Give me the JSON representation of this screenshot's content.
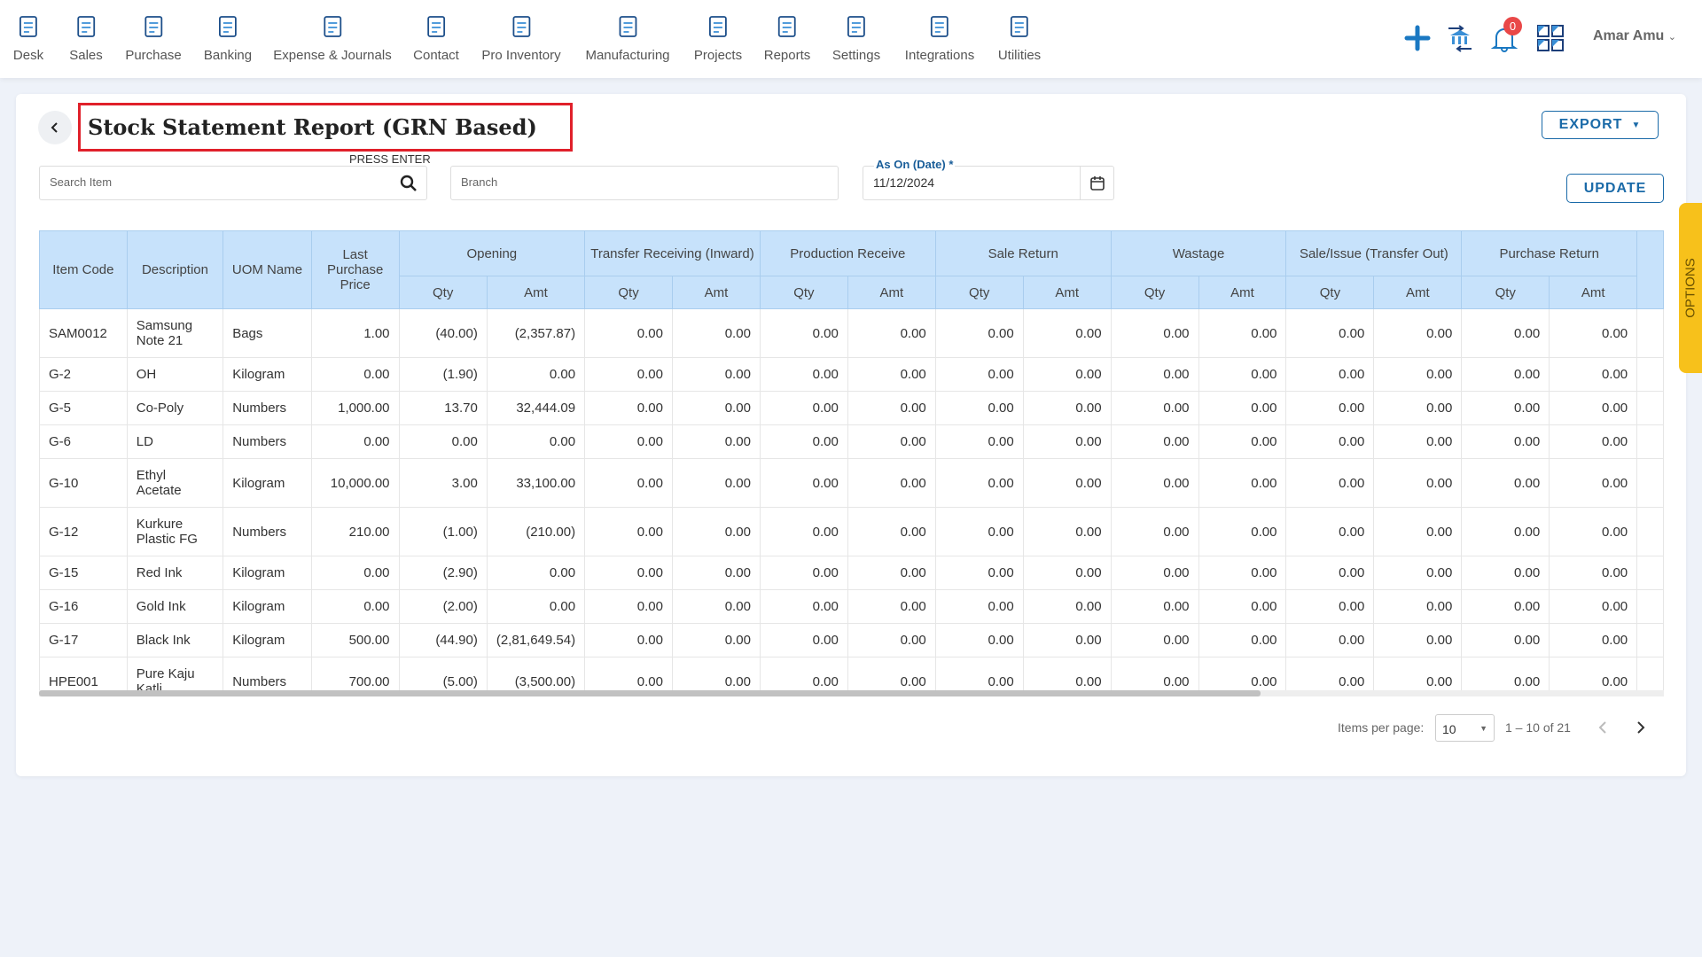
{
  "nav": {
    "items": [
      {
        "label": "Desk",
        "icon": "desk-icon"
      },
      {
        "label": "Sales",
        "icon": "sales-icon"
      },
      {
        "label": "Purchase",
        "icon": "cart-icon"
      },
      {
        "label": "Banking",
        "icon": "bank-icon"
      },
      {
        "label": "Expense & Journals",
        "icon": "journal-icon"
      },
      {
        "label": "Contact",
        "icon": "contact-icon"
      },
      {
        "label": "Pro Inventory",
        "icon": "inventory-icon"
      },
      {
        "label": "Manufacturing",
        "icon": "manufacturing-icon"
      },
      {
        "label": "Projects",
        "icon": "projects-icon"
      },
      {
        "label": "Reports",
        "icon": "reports-icon"
      },
      {
        "label": "Settings",
        "icon": "settings-icon"
      },
      {
        "label": "Integrations",
        "icon": "integrations-icon"
      },
      {
        "label": "Utilities",
        "icon": "utilities-icon"
      }
    ],
    "notification_count": "0",
    "user": "Amar Amu"
  },
  "page": {
    "title": "Stock Statement Report (GRN Based)",
    "press_enter": "PRESS ENTER",
    "search_placeholder": "Search Item",
    "branch_placeholder": "Branch",
    "date_label": "As On (Date) *",
    "date_value": "11/12/2024",
    "export": "EXPORT",
    "update": "UPDATE",
    "options": "OPTIONS"
  },
  "colors": {
    "accent": "#1a6aa8",
    "header_bg": "#c7e2fb",
    "options_tab": "#f7c11b",
    "title_border": "#e0202a"
  },
  "table": {
    "fixed_headers": [
      "Item Code",
      "Description",
      "UOM Name",
      "Last Purchase Price"
    ],
    "groups": [
      "Opening",
      "Transfer Receiving (Inward)",
      "Production Receive",
      "Sale Return",
      "Wastage",
      "Sale/Issue (Transfer Out)",
      "Purchase Return"
    ],
    "sub": [
      "Qty",
      "Amt"
    ],
    "rows": [
      [
        "SAM0012",
        "Samsung Note 21",
        "Bags",
        "1.00",
        "(40.00)",
        "(2,357.87)"
      ],
      [
        "G-2",
        "OH",
        "Kilogram",
        "0.00",
        "(1.90)",
        "0.00"
      ],
      [
        "G-5",
        "Co-Poly",
        "Numbers",
        "1,000.00",
        "13.70",
        "32,444.09"
      ],
      [
        "G-6",
        "LD",
        "Numbers",
        "0.00",
        "0.00",
        "0.00"
      ],
      [
        "G-10",
        "Ethyl Acetate",
        "Kilogram",
        "10,000.00",
        "3.00",
        "33,100.00"
      ],
      [
        "G-12",
        "Kurkure Plastic FG",
        "Numbers",
        "210.00",
        "(1.00)",
        "(210.00)"
      ],
      [
        "G-15",
        "Red Ink",
        "Kilogram",
        "0.00",
        "(2.90)",
        "0.00"
      ],
      [
        "G-16",
        "Gold Ink",
        "Kilogram",
        "0.00",
        "(2.00)",
        "0.00"
      ],
      [
        "G-17",
        "Black Ink",
        "Kilogram",
        "500.00",
        "(44.90)",
        "(2,81,649.54)"
      ],
      [
        "HPE001",
        "Pure Kaju Katli",
        "Numbers",
        "700.00",
        "(5.00)",
        "(3,500.00)"
      ]
    ],
    "other_value": "0.00"
  },
  "pagination": {
    "label": "Items per page:",
    "per_page": "10",
    "range": "1 – 10 of 21"
  }
}
